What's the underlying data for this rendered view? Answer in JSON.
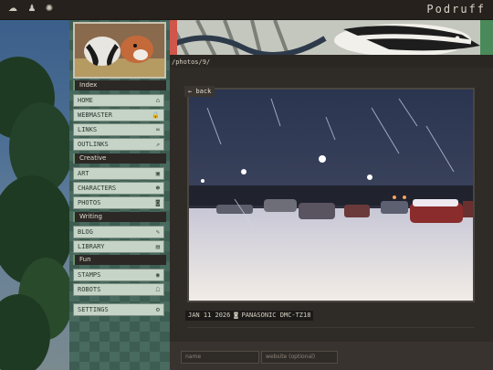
{
  "topbar": {
    "brand": "Podruff",
    "icons": [
      "cloud-icon",
      "tooth-icon",
      "sun-icon"
    ]
  },
  "path": "/photos/9/",
  "sidebar": {
    "sections": [
      {
        "label": "Index",
        "items": [
          {
            "label": "HOME",
            "icon": "home-icon"
          },
          {
            "label": "WEBMASTER",
            "icon": "lock-icon"
          },
          {
            "label": "LINKS",
            "icon": "link-icon"
          },
          {
            "label": "OUTLINKS",
            "icon": "external-icon"
          }
        ]
      },
      {
        "label": "Creative",
        "items": [
          {
            "label": "ART",
            "icon": "image-icon"
          },
          {
            "label": "CHARACTERS",
            "icon": "people-icon"
          },
          {
            "label": "PHOTOS",
            "icon": "camera-icon"
          }
        ]
      },
      {
        "label": "Writing",
        "items": [
          {
            "label": "BLOG",
            "icon": "pen-icon"
          },
          {
            "label": "LIBRARY",
            "icon": "book-icon"
          }
        ]
      },
      {
        "label": "Fun",
        "items": [
          {
            "label": "STAMPS",
            "icon": "stamp-icon"
          },
          {
            "label": "ROBOTS",
            "icon": "robot-icon"
          }
        ]
      }
    ],
    "settings": {
      "label": "SETTINGS",
      "icon": "gear-icon"
    }
  },
  "photo": {
    "back_label": "← back",
    "date": "JAN 11 2026",
    "camera": "PANASONIC DMC-TZ18"
  },
  "comment_form": {
    "name_placeholder": "name",
    "website_placeholder": "website (optional)"
  }
}
